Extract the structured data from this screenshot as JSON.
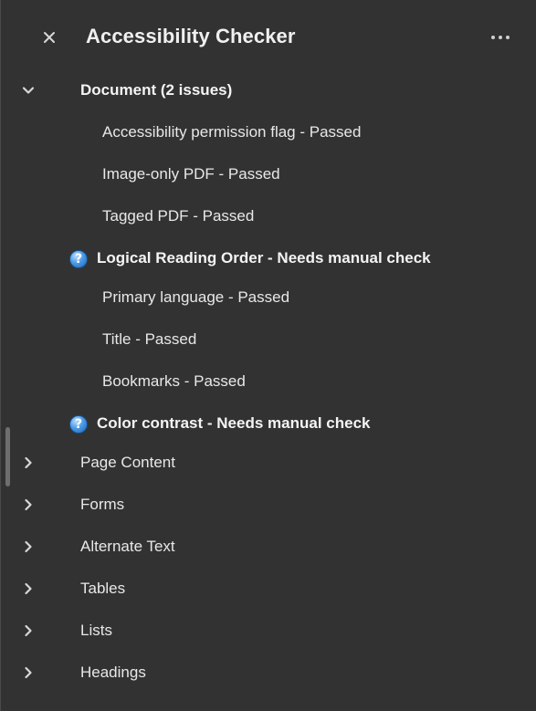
{
  "header": {
    "title": "Accessibility Checker"
  },
  "icons": {
    "close": "close-icon",
    "more": "more-horizontal-icon",
    "expanded": "chevron-down-icon",
    "collapsed": "chevron-right-icon",
    "help": "question-circle-icon"
  },
  "document": {
    "label": "Document (2 issues)",
    "items": [
      {
        "label": "Accessibility permission flag - Passed"
      },
      {
        "label": "Image-only PDF - Passed"
      },
      {
        "label": "Tagged PDF - Passed"
      },
      {
        "label": "Logical Reading Order - Needs manual check"
      },
      {
        "label": "Primary language - Passed"
      },
      {
        "label": "Title - Passed"
      },
      {
        "label": "Bookmarks - Passed"
      },
      {
        "label": "Color contrast - Needs manual check"
      }
    ]
  },
  "sections": [
    {
      "label": "Page Content"
    },
    {
      "label": "Forms"
    },
    {
      "label": "Alternate Text"
    },
    {
      "label": "Tables"
    },
    {
      "label": "Lists"
    },
    {
      "label": "Headings"
    }
  ]
}
